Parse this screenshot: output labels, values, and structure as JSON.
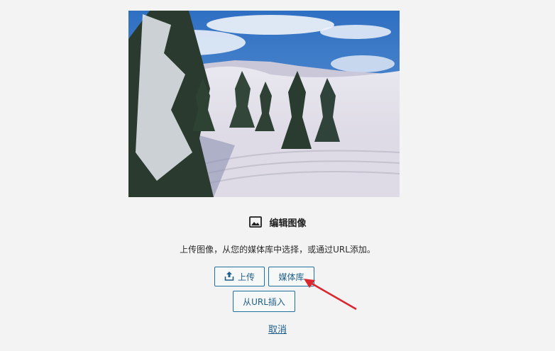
{
  "image_placeholder": {
    "title": "编辑图像",
    "title_icon": "image-icon",
    "instructions": "上传图像，从您的媒体库中选择，或通过URL添加。",
    "buttons": {
      "upload_label": "上传",
      "upload_icon": "upload-icon",
      "media_library_label": "媒体库",
      "url_insert_label": "从URL插入"
    },
    "cancel_label": "取消"
  },
  "colors": {
    "accent": "#1f6f9f",
    "annotation_arrow": "#d9272e",
    "background": "#f3f3f3"
  }
}
